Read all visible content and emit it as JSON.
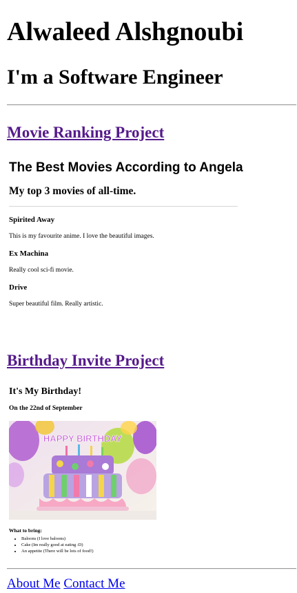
{
  "header": {
    "name": "Alwaleed Alshgnoubi",
    "role": "I'm a Software Engineer"
  },
  "projects": [
    {
      "link": "Movie Ranking Project",
      "embed": {
        "title": "The Best Movies According to Angela",
        "subtitle": "My top 3 movies of all-time.",
        "movies": [
          {
            "title": "Spirited Away",
            "desc": "This is my favourite anime. I love the beautiful images."
          },
          {
            "title": "Ex Machina",
            "desc": "Really cool sci-fi movie."
          },
          {
            "title": "Drive",
            "desc": "Super beautiful film. Really artistic."
          }
        ]
      }
    },
    {
      "link": "Birthday Invite Project",
      "embed": {
        "title": "It's My Birthday!",
        "subtitle": "On the 22nd of September",
        "cake_text": "HAPPY BIRTHDAY",
        "bring_label": "What to bring:",
        "items": [
          "Baloons (I love baloons)",
          "Cake (Im really good at eating :D)",
          "An appetite (There will be lots of food!)"
        ]
      }
    }
  ],
  "footer": {
    "about": "About Me",
    "contact": "Contact Me"
  },
  "colors": {
    "visited_link": "#551a8b",
    "link": "#0000ee"
  }
}
